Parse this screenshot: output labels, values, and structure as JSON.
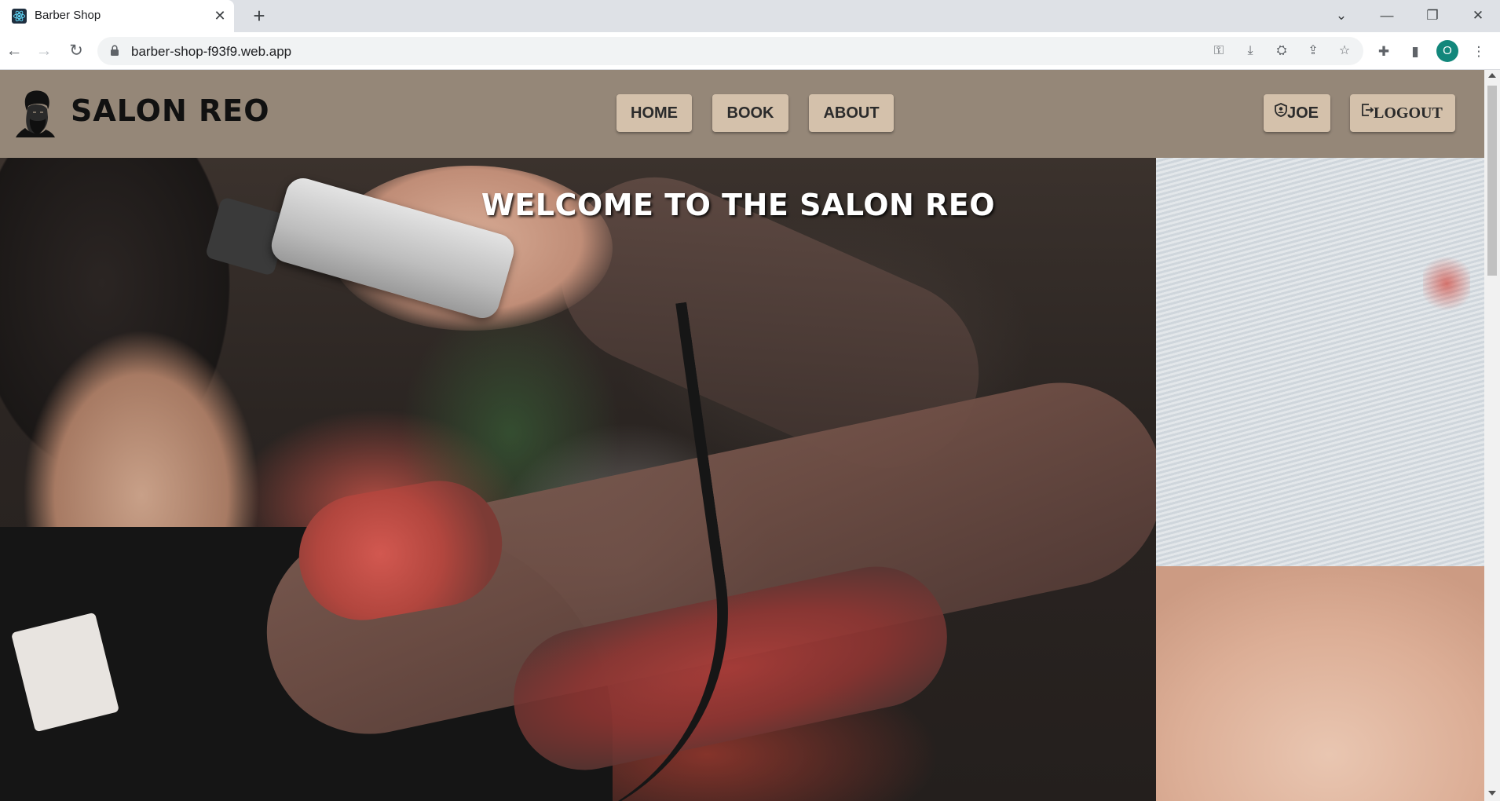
{
  "browser": {
    "tab_title": "Barber Shop",
    "tab_close": "✕",
    "new_tab": "+",
    "url": "barber-shop-f93f9.web.app",
    "profile_initial": "O",
    "window_controls": {
      "list": "⌄",
      "minimize": "—",
      "restore": "❐",
      "close": "✕"
    }
  },
  "site": {
    "title": "SALON REO",
    "nav": [
      {
        "label": "HOME"
      },
      {
        "label": "BOOK"
      },
      {
        "label": "ABOUT"
      }
    ],
    "user_label": "JOE",
    "logout_label": "LOGOUT"
  },
  "hero": {
    "heading": "WELCOME TO THE SALON REO"
  },
  "colors": {
    "header_bg": "#958778",
    "button_bg": "#d4c1ab",
    "profile_bg": "#12877b"
  },
  "icons": {
    "logo": "bearded-man-logo-icon",
    "user": "user-shield-icon",
    "logout": "logout-icon"
  }
}
